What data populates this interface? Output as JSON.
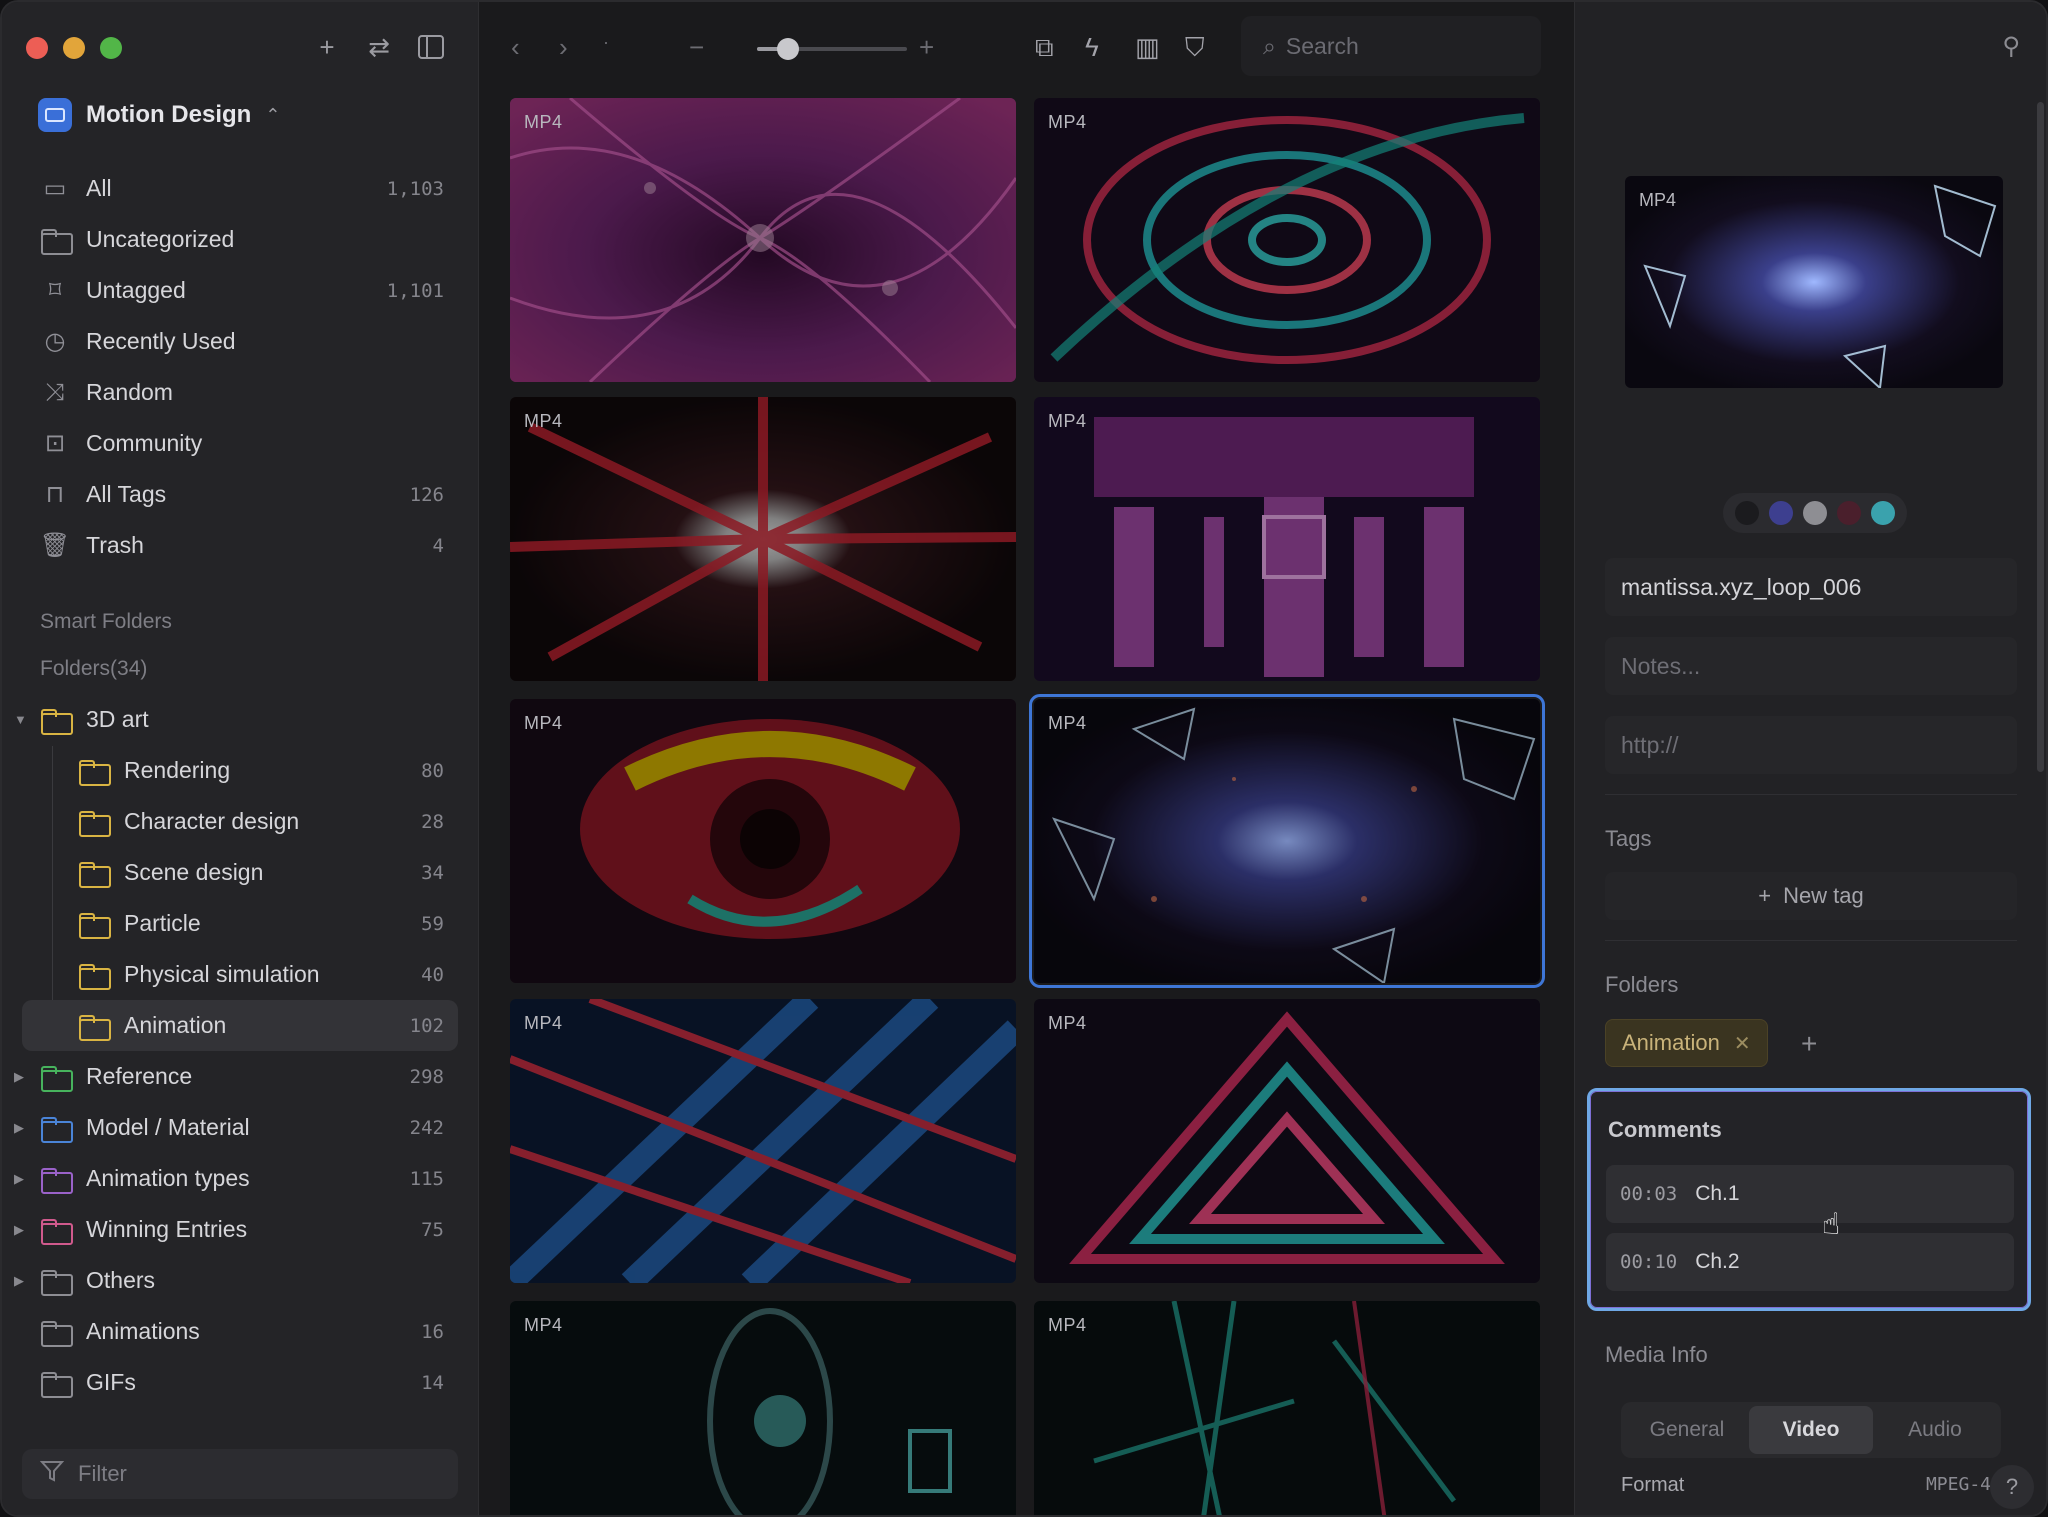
{
  "library": {
    "name": "Motion Design"
  },
  "nav": [
    {
      "label": "All",
      "count": "1,103",
      "icon": "inbox-icon"
    },
    {
      "label": "Uncategorized",
      "count": "",
      "icon": "folder-question-icon"
    },
    {
      "label": "Untagged",
      "count": "1,101",
      "icon": "tag-question-icon"
    },
    {
      "label": "Recently Used",
      "count": "",
      "icon": "clock-icon"
    },
    {
      "label": "Random",
      "count": "",
      "icon": "shuffle-icon"
    },
    {
      "label": "Community",
      "count": "",
      "icon": "download-box-icon"
    },
    {
      "label": "All Tags",
      "count": "126",
      "icon": "bookmark-icon"
    },
    {
      "label": "Trash",
      "count": "4",
      "icon": "trash-icon"
    }
  ],
  "sections": {
    "smart_folders": "Smart Folders",
    "folders": "Folders(34)"
  },
  "folders": [
    {
      "label": "3D art",
      "count": "",
      "color": "#d9b443"
    },
    {
      "label": "Rendering",
      "count": "80",
      "color": "#d9b443"
    },
    {
      "label": "Character design",
      "count": "28",
      "color": "#d9b443"
    },
    {
      "label": "Scene design",
      "count": "34",
      "color": "#d9b443"
    },
    {
      "label": "Particle",
      "count": "59",
      "color": "#d9b443"
    },
    {
      "label": "Physical simulation",
      "count": "40",
      "color": "#d9b443"
    },
    {
      "label": "Animation",
      "count": "102",
      "color": "#d9b443"
    },
    {
      "label": "Reference",
      "count": "298",
      "color": "#47b35d"
    },
    {
      "label": "Model / Material",
      "count": "242",
      "color": "#4a84d8"
    },
    {
      "label": "Animation types",
      "count": "115",
      "color": "#9a62c9"
    },
    {
      "label": "Winning Entries",
      "count": "75",
      "color": "#d05a8d"
    },
    {
      "label": "Others",
      "count": "",
      "color": "#8d8d93"
    },
    {
      "label": "Animations",
      "count": "16",
      "color": "#8d8d93"
    },
    {
      "label": "GIFs",
      "count": "14",
      "color": "#8d8d93"
    }
  ],
  "filter": {
    "placeholder": "Filter"
  },
  "toolbar": {
    "search_placeholder": "Search"
  },
  "grid": {
    "items": [
      {
        "format": "MP4"
      },
      {
        "format": "MP4"
      },
      {
        "format": "MP4"
      },
      {
        "format": "MP4"
      },
      {
        "format": "MP4"
      },
      {
        "format": "MP4"
      },
      {
        "format": "MP4"
      },
      {
        "format": "MP4"
      },
      {
        "format": "MP4"
      },
      {
        "format": "MP4"
      }
    ]
  },
  "inspector": {
    "preview_format": "MP4",
    "palette": [
      "#1b1b1e",
      "#3d3f8f",
      "#8e8e93",
      "#4a1f2c",
      "#3aa2ad"
    ],
    "filename": "mantissa.xyz_loop_006",
    "notes_placeholder": "Notes...",
    "url_placeholder": "http://",
    "tags_label": "Tags",
    "new_tag": "New tag",
    "folders_label": "Folders",
    "folder_chip": "Animation",
    "comments_label": "Comments",
    "comments": [
      {
        "time": "00:03",
        "text": "Ch.1"
      },
      {
        "time": "00:10",
        "text": "Ch.2"
      }
    ],
    "media_info_label": "Media Info",
    "tabs": [
      "General",
      "Video",
      "Audio"
    ],
    "active_tab": "Video",
    "format_label": "Format",
    "format_value": "MPEG-4",
    "help": "?"
  }
}
